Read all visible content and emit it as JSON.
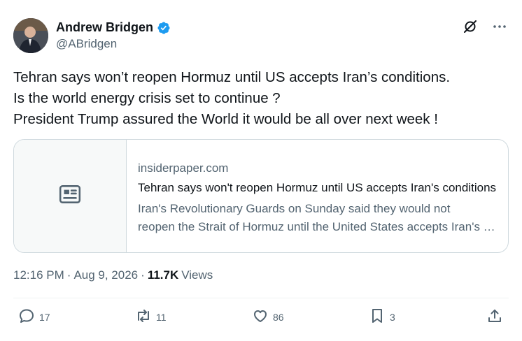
{
  "author": {
    "display_name": "Andrew Bridgen",
    "handle": "@ABridgen"
  },
  "tweet": {
    "lines": [
      "Tehran says won’t reopen Hormuz until US accepts Iran’s conditions.",
      "Is the world energy crisis set to continue ?",
      "President Trump assured the World it would be all over next week !"
    ]
  },
  "card": {
    "domain": "insiderpaper.com",
    "title": "Tehran says won't reopen Hormuz until US accepts Iran's conditions",
    "desc_lines": [
      "Iran's Revolutionary Guards on Sunday said they would not",
      "reopen the Strait of Hormuz until the United States accepts Iran's conditions"
    ]
  },
  "meta": {
    "time": "12:16 PM",
    "sep1": "·",
    "date": "Aug 9, 2026",
    "sep2": "·",
    "views_count": "11.7K",
    "views_label": "Views"
  },
  "actions": {
    "replies": "17",
    "reposts": "11",
    "likes": "86",
    "bookmarks": "3"
  },
  "colors": {
    "verified": "#1d9bf0",
    "secondary_text": "#536471",
    "border": "#cfd9de"
  },
  "icons": [
    "verified-badge-icon",
    "grok-icon",
    "more-icon",
    "article-icon",
    "reply-icon",
    "repost-icon",
    "like-icon",
    "bookmark-icon",
    "share-icon"
  ]
}
